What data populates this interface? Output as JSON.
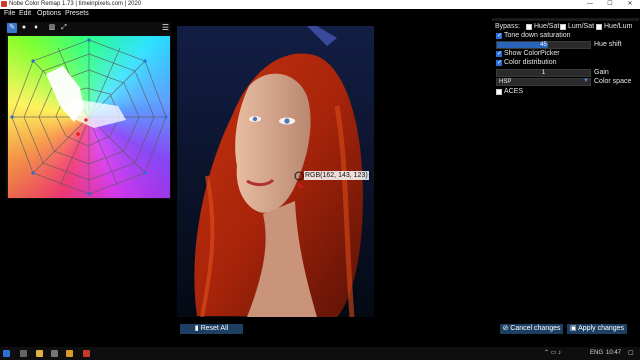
{
  "window": {
    "title": "Nobe Color Remap 1.73 | timeinpixels.com | 2020",
    "controls": {
      "minimize": "—",
      "maximize": "☐",
      "close": "✕"
    }
  },
  "menu": [
    "File",
    "Edit",
    "Options",
    "Presets"
  ],
  "wheel_panel": {
    "tools": [
      "pen-icon",
      "dot-icon",
      "drop-icon",
      "bars-icon",
      "expand-icon"
    ],
    "menu_icon": "☰"
  },
  "image": {
    "picker_label": "RGB(162, 143, 123)"
  },
  "buttons": {
    "reset_all": "Reset All",
    "cancel": "Cancel changes",
    "apply": "Apply changes"
  },
  "controls": {
    "bypass_label": "Bypass:",
    "bypass_options": [
      {
        "label": "Hue/Sat",
        "checked": false
      },
      {
        "label": "Lum/Sat",
        "checked": false
      },
      {
        "label": "Hue/Lum",
        "checked": false
      }
    ],
    "tone_down_saturation": {
      "label": "Tone down saturation",
      "checked": true
    },
    "hue_shift": {
      "value": "45",
      "label": "Hue shift",
      "fraction": 0.55
    },
    "show_color_picker": {
      "label": "Show ColorPicker",
      "checked": true
    },
    "color_distribution": {
      "label": "Color distribution",
      "checked": true
    },
    "gain": {
      "value": "1",
      "label": "Gain",
      "fraction": 0.0
    },
    "color_space": {
      "value": "HSP",
      "label": "Color space"
    },
    "aces": {
      "label": "ACES",
      "checked": false
    }
  },
  "taskbar": {
    "language": "ENG",
    "time": "10:47"
  },
  "colors": {
    "accent": "#2d6fd6",
    "button_bg": "#1d3f62",
    "background": "#000000"
  }
}
